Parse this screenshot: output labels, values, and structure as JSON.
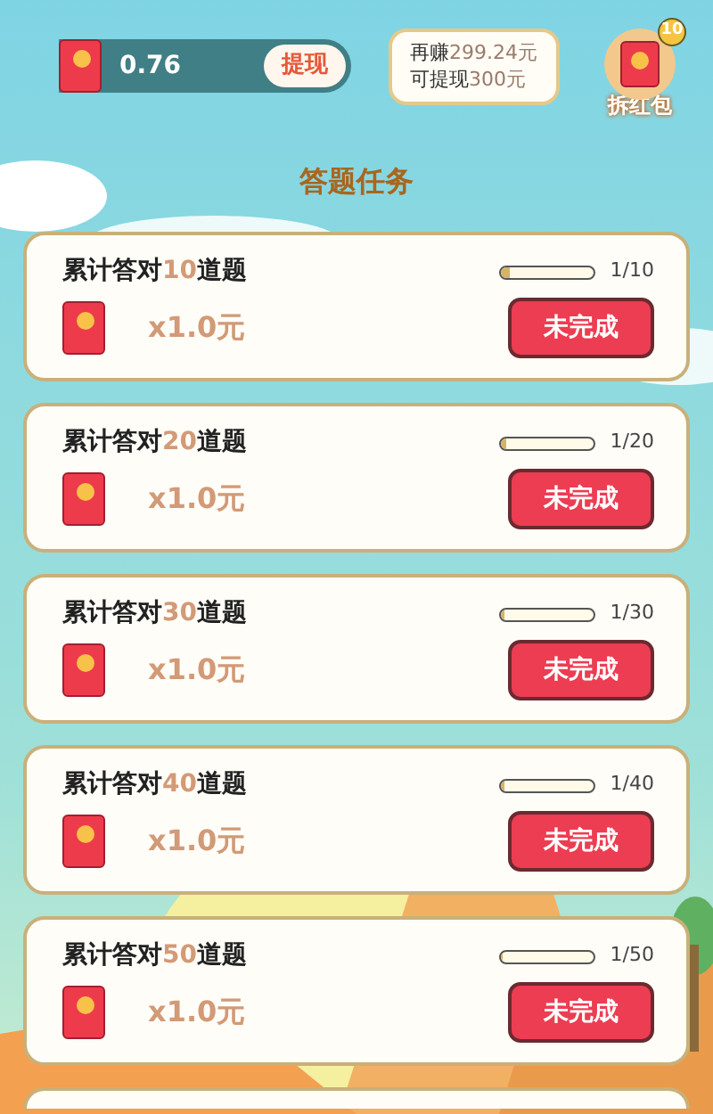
{
  "balance": {
    "amount": "0.76",
    "button": "提现"
  },
  "tip": {
    "line1_prefix": "再赚",
    "line1_value": "299.24元",
    "line2_prefix": "可提现",
    "line2_value": "300元"
  },
  "red_packet": {
    "badge": "10",
    "label": "拆红包"
  },
  "section_title": "答题任务",
  "tasks": [
    {
      "prefix": "累计答对",
      "count": "10",
      "suffix": "道题",
      "progress": "1/10",
      "level": 0.1,
      "reward": "x1.0元",
      "button": "未完成"
    },
    {
      "prefix": "累计答对",
      "count": "20",
      "suffix": "道题",
      "progress": "1/20",
      "level": 0.05,
      "reward": "x1.0元",
      "button": "未完成"
    },
    {
      "prefix": "累计答对",
      "count": "30",
      "suffix": "道题",
      "progress": "1/30",
      "level": 0.033,
      "reward": "x1.0元",
      "button": "未完成"
    },
    {
      "prefix": "累计答对",
      "count": "40",
      "suffix": "道题",
      "progress": "1/40",
      "level": 0.025,
      "reward": "x1.0元",
      "button": "未完成"
    },
    {
      "prefix": "累计答对",
      "count": "50",
      "suffix": "道题",
      "progress": "1/50",
      "level": 0.02,
      "reward": "x1.0元",
      "button": "未完成"
    }
  ]
}
